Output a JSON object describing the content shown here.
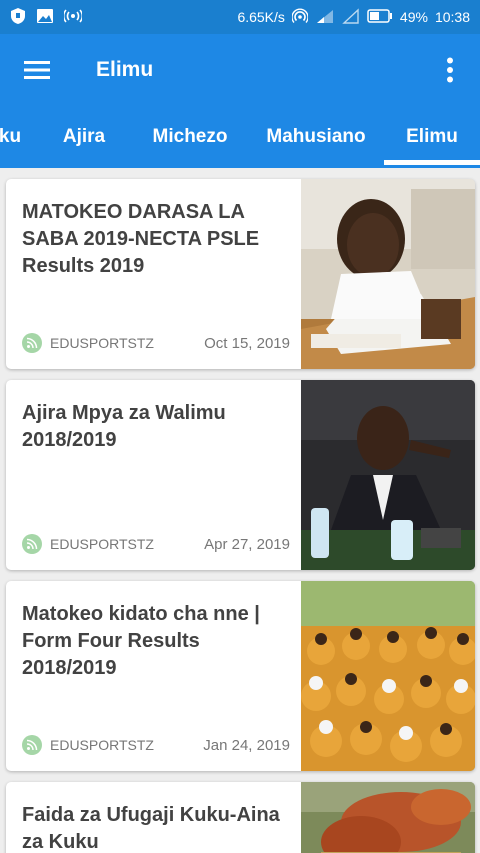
{
  "status_bar": {
    "network_speed": "6.65K/s",
    "battery": "49%",
    "time": "10:38"
  },
  "app_bar": {
    "title": "Elimu",
    "menu_icon": "hamburger-menu-icon",
    "overflow_icon": "more-vert-icon"
  },
  "tabs": [
    {
      "label": "ku"
    },
    {
      "label": "Ajira"
    },
    {
      "label": "Michezo"
    },
    {
      "label": "Mahusiano"
    },
    {
      "label": "Elimu",
      "selected": true
    }
  ],
  "articles": [
    {
      "title": "MATOKEO DARASA LA SABA 2019-NECTA PSLE Results 2019",
      "source": "EDUSPORTSTZ",
      "date": "Oct 15, 2019"
    },
    {
      "title": "Ajira Mpya za Walimu 2018/2019",
      "source": "EDUSPORTSTZ",
      "date": "Apr 27, 2019"
    },
    {
      "title": "Matokeo kidato cha nne | Form Four Results 2018/2019",
      "source": "EDUSPORTSTZ",
      "date": "Jan 24, 2019"
    },
    {
      "title": "Faida za Ufugaji Kuku-Aina za Kuku",
      "source": "",
      "date": ""
    }
  ],
  "colors": {
    "primary": "#1e88e5",
    "status_bar": "#1a7fcf",
    "source_badge": "#a5d6a7"
  }
}
